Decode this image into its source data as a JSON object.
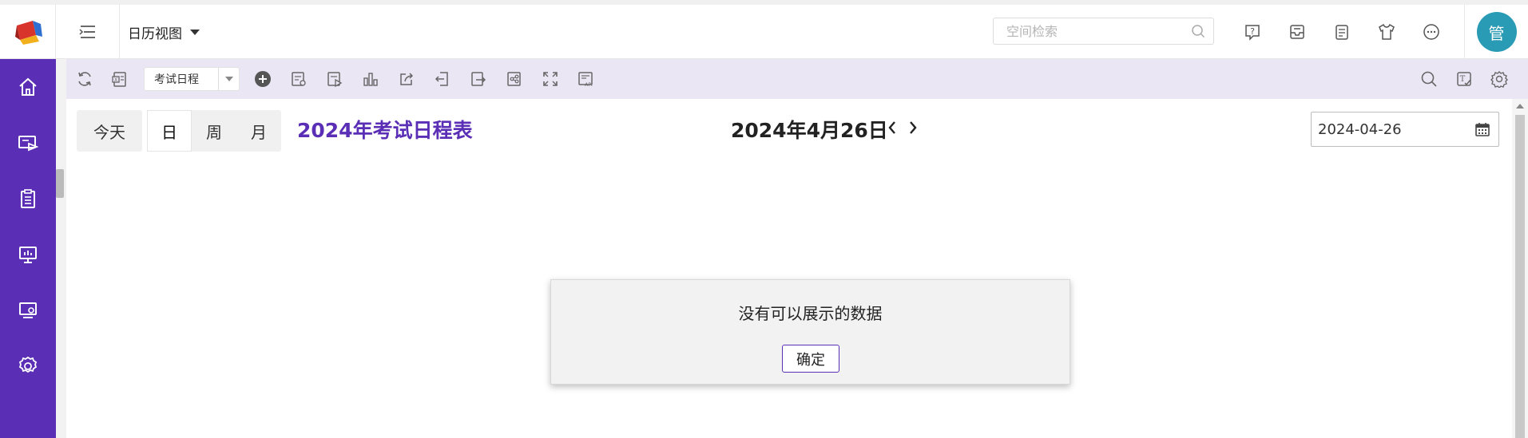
{
  "header": {
    "view_label": "日历视图",
    "search_placeholder": "空间检索",
    "avatar_text": "管"
  },
  "toolbar": {
    "schedule_select_value": "考试日程"
  },
  "calendar": {
    "today_label": "今天",
    "views": [
      "日",
      "周",
      "月"
    ],
    "active_view": "日",
    "title": "2024年考试日程表",
    "current_date": "2024年4月26日",
    "date_input_value": "2024-04-26"
  },
  "dialog": {
    "message": "没有可以展示的数据",
    "ok_label": "确定"
  },
  "colors": {
    "sidebar": "#5a2fb5",
    "accent": "#5a2fb5",
    "avatar": "#2a9bb5",
    "toolbar_bg": "#ebe6f4"
  },
  "sidebar_icons": [
    "home-icon",
    "media-screen-icon",
    "clipboard-icon",
    "presentation-icon",
    "monitor-settings-icon",
    "settings-icon"
  ]
}
